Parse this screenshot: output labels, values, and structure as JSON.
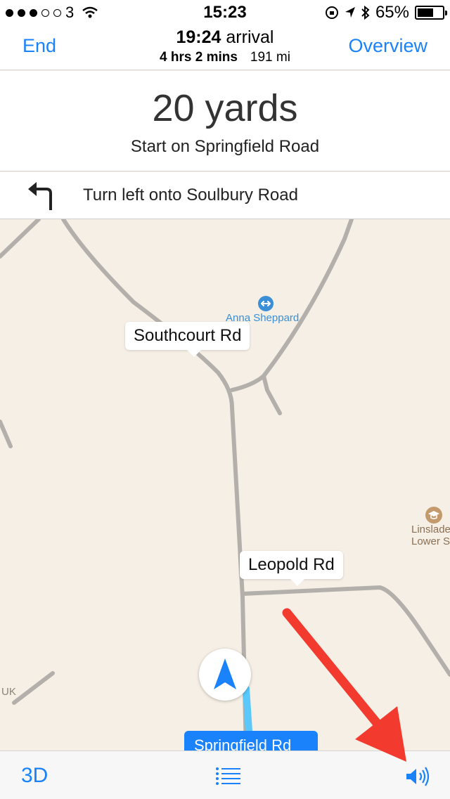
{
  "status_bar": {
    "carrier": "3",
    "time": "15:23",
    "battery": "65%",
    "battery_level": 0.65,
    "signal_bars": 3,
    "signal_total": 5
  },
  "nav": {
    "end_label": "End",
    "overview_label": "Overview",
    "arrival_time": "19:24",
    "arrival_word": "arrival",
    "duration": "4 hrs 2 mins",
    "distance": "191 mi"
  },
  "instruction": {
    "distance": "20 yards",
    "street": "Start on Springfield Road"
  },
  "next_step": {
    "label": "Turn left onto Soulbury Road"
  },
  "map": {
    "callouts": {
      "southcourt": "Southcourt Rd",
      "leopold": "Leopold Rd"
    },
    "poi_anna": "Anna Sheppard",
    "poi_school_line1": "Linslade",
    "poi_school_line2": "Lower Sch",
    "edge_label": "UK",
    "current_road": "Springfield Rd"
  },
  "toolbar": {
    "three_d": "3D"
  },
  "colors": {
    "accent": "#1a82fb",
    "map_bg": "#f5efe6",
    "road": "#b3b0ab",
    "route": "#5ac8fa",
    "annotation_arrow": "#f33a2e"
  },
  "icons": {
    "turn": "turn-left-arrow-icon",
    "location": "navigation-arrow-icon",
    "list": "list-icon",
    "audio": "speaker-icon",
    "poi_anna": "poi-arrows-icon",
    "poi_school": "graduation-cap-icon"
  }
}
